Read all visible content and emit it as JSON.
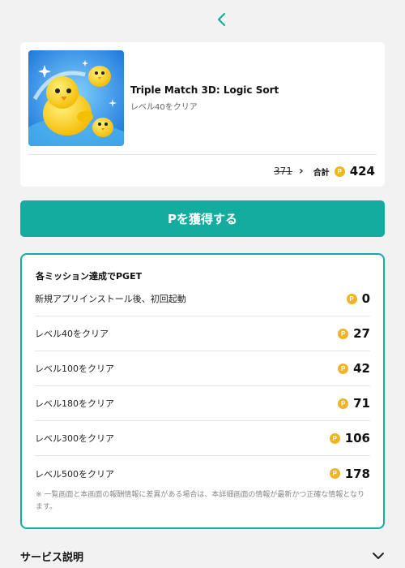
{
  "header": {
    "back_icon": "chevron-left-icon",
    "accent_color": "#14ac9f"
  },
  "app": {
    "title": "Triple Match 3D: Logic Sort",
    "subtitle": "レベル40をクリア",
    "old_points": "371",
    "total_label": "合計",
    "total_points": "424",
    "coin_letter": "P"
  },
  "get_button": {
    "label": "Pを獲得する"
  },
  "missions": {
    "heading": "各ミッション達成でPGET",
    "items": [
      {
        "label": "新規アプリインストール後、初回起動",
        "points": "0"
      },
      {
        "label": "レベル40をクリア",
        "points": "27"
      },
      {
        "label": "レベル100をクリア",
        "points": "42"
      },
      {
        "label": "レベル180をクリア",
        "points": "71"
      },
      {
        "label": "レベル300をクリア",
        "points": "106"
      },
      {
        "label": "レベル500をクリア",
        "points": "178"
      }
    ],
    "note": "※ 一覧画面と本画面の報酬情報に差異がある場合は、本詳細画面の情報が最新かつ正確な情報となります。"
  },
  "service": {
    "title": "サービス説明",
    "expand_icon": "chevron-down-icon"
  },
  "colors": {
    "accent": "#14ac9f",
    "coin": "#f0b429"
  }
}
